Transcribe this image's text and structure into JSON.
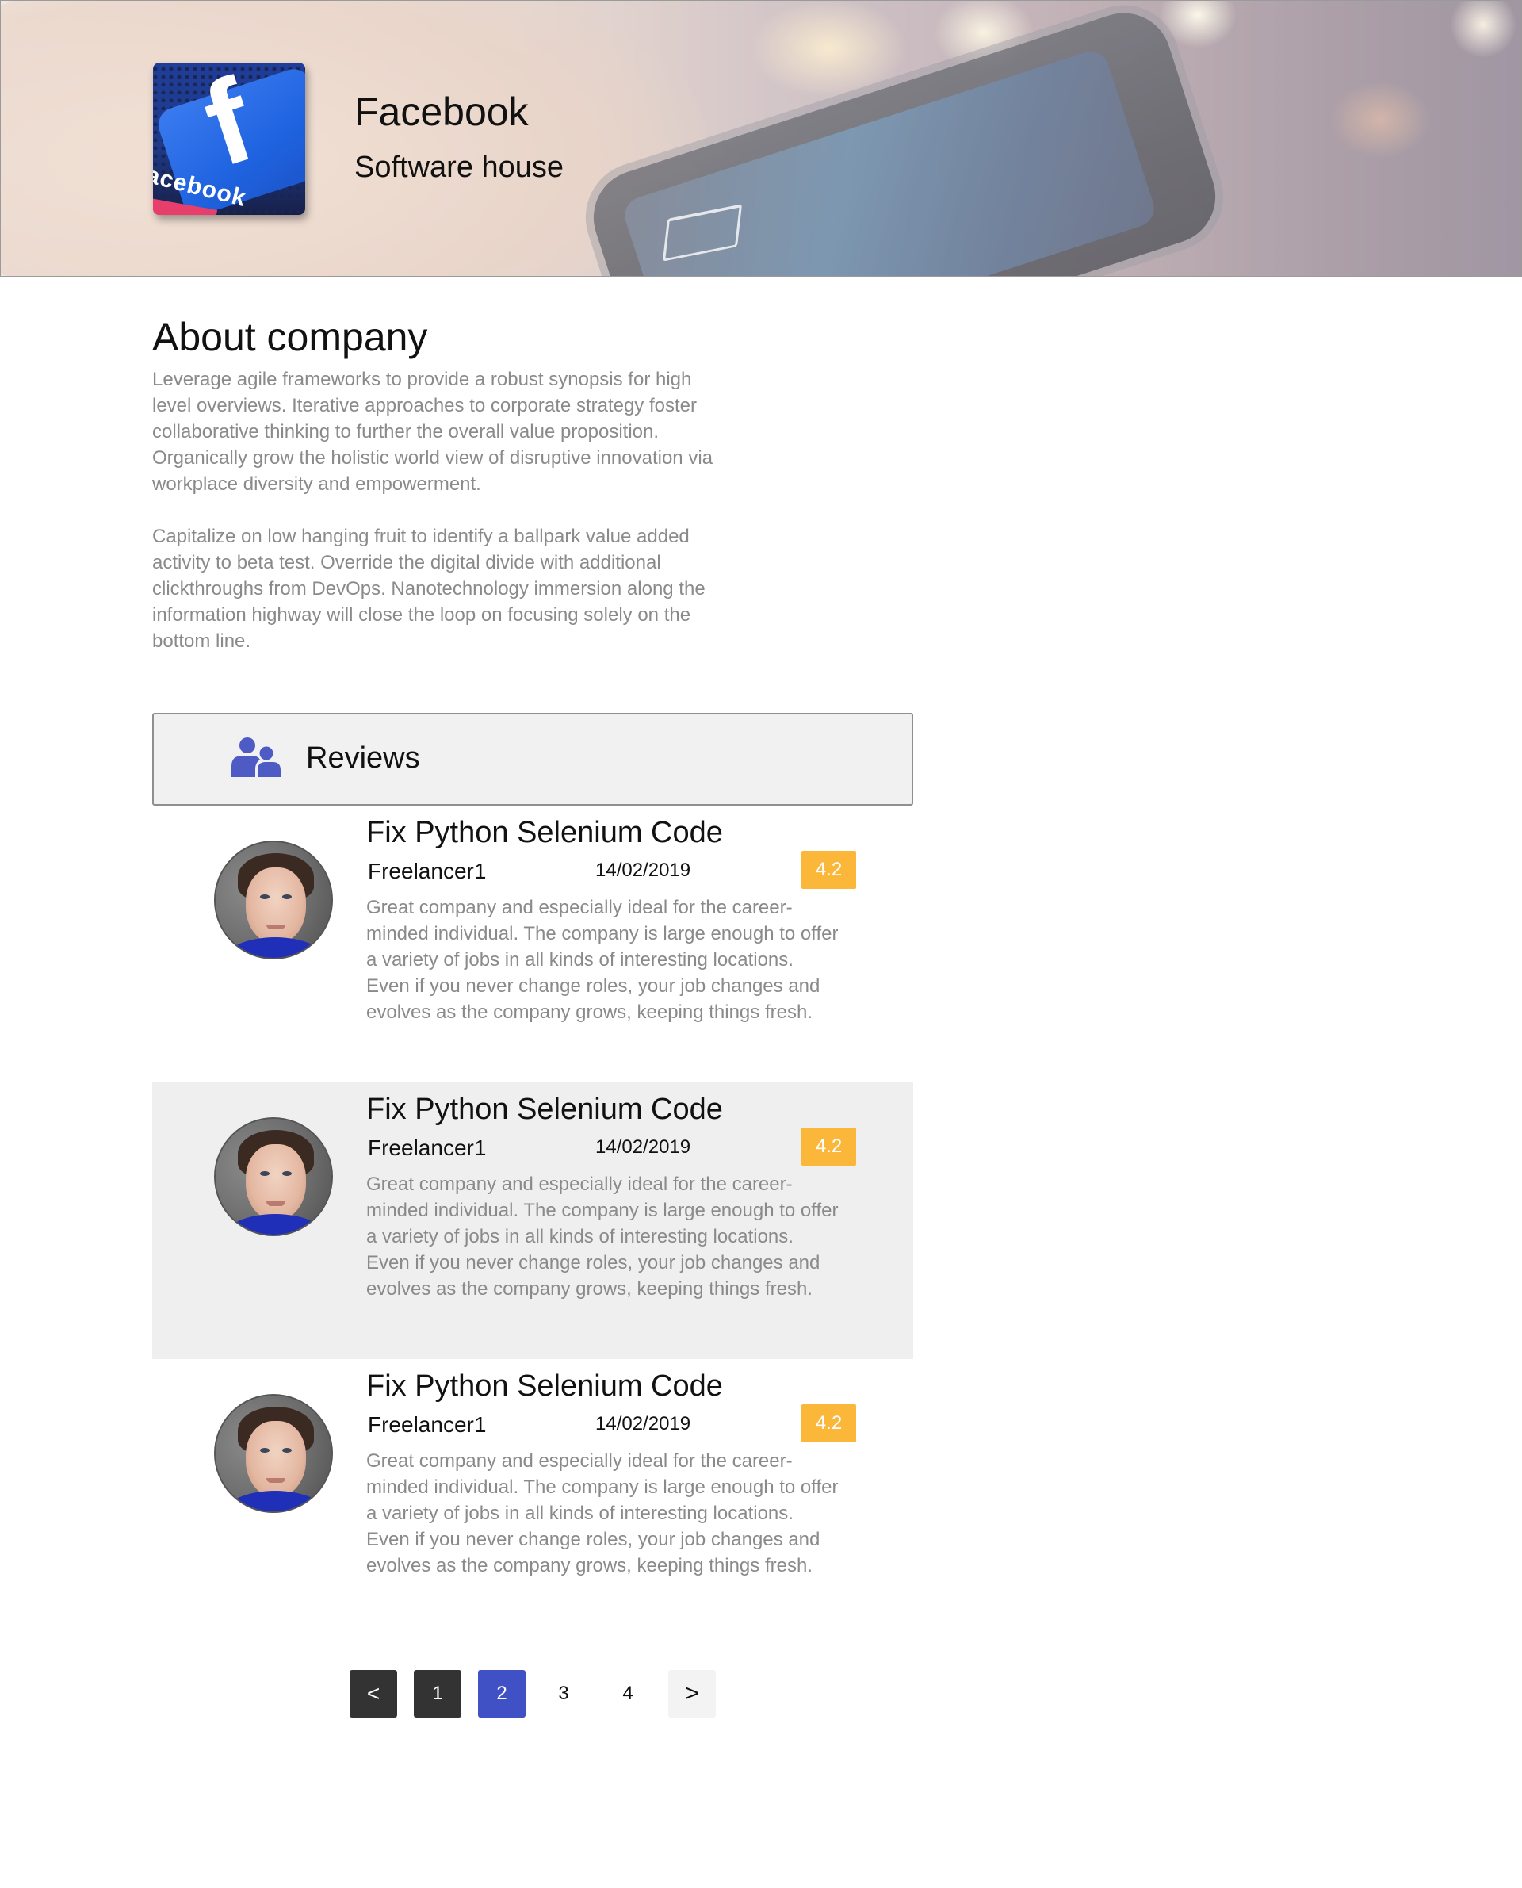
{
  "header": {
    "company_name": "Facebook",
    "company_type": "Software house",
    "logo_text": "acebook"
  },
  "about": {
    "title": "About company",
    "paragraphs": [
      "Leverage agile frameworks to provide a robust synopsis for high level overviews. Iterative approaches to corporate strategy foster collaborative thinking to further the overall value proposition. Organically grow the holistic world view of disruptive innovation via workplace diversity and empowerment.",
      "Capitalize on low hanging fruit to identify a ballpark value added activity to beta test. Override the digital divide with additional clickthroughs from DevOps. Nanotechnology immersion along the information highway will close the loop on focusing solely on the bottom line."
    ]
  },
  "reviews": {
    "title": "Reviews",
    "icon": "users-icon",
    "items": [
      {
        "title": "Fix Python Selenium Code",
        "author": "Freelancer1",
        "date": "14/02/2019",
        "rating": "4.2",
        "body": "Great company and especially ideal for the career-minded individual. The company is large enough to offer a variety of jobs in all kinds of interesting locations. Even if you never change roles, your job changes and evolves as the company grows, keeping things fresh."
      },
      {
        "title": "Fix Python Selenium Code",
        "author": "Freelancer1",
        "date": "14/02/2019",
        "rating": "4.2",
        "body": "Great company and especially ideal for the career-minded individual. The company is large enough to offer a variety of jobs in all kinds of interesting locations. Even if you never change roles, your job changes and evolves as the company grows, keeping things fresh."
      },
      {
        "title": "Fix Python Selenium Code",
        "author": "Freelancer1",
        "date": "14/02/2019",
        "rating": "4.2",
        "body": "Great company and especially ideal for the career-minded individual. The company is large enough to offer a variety of jobs in all kinds of interesting locations. Even if you never change roles, your job changes and evolves as the company grows, keeping things fresh."
      }
    ]
  },
  "pagination": {
    "prev": "<",
    "pages": [
      "1",
      "2",
      "3",
      "4"
    ],
    "current": "2",
    "next": ">"
  },
  "colors": {
    "rating_badge": "#fbb73a",
    "active_page": "#3f51c4",
    "dark_button": "#333333",
    "reviews_icon": "#4f5bc4"
  }
}
